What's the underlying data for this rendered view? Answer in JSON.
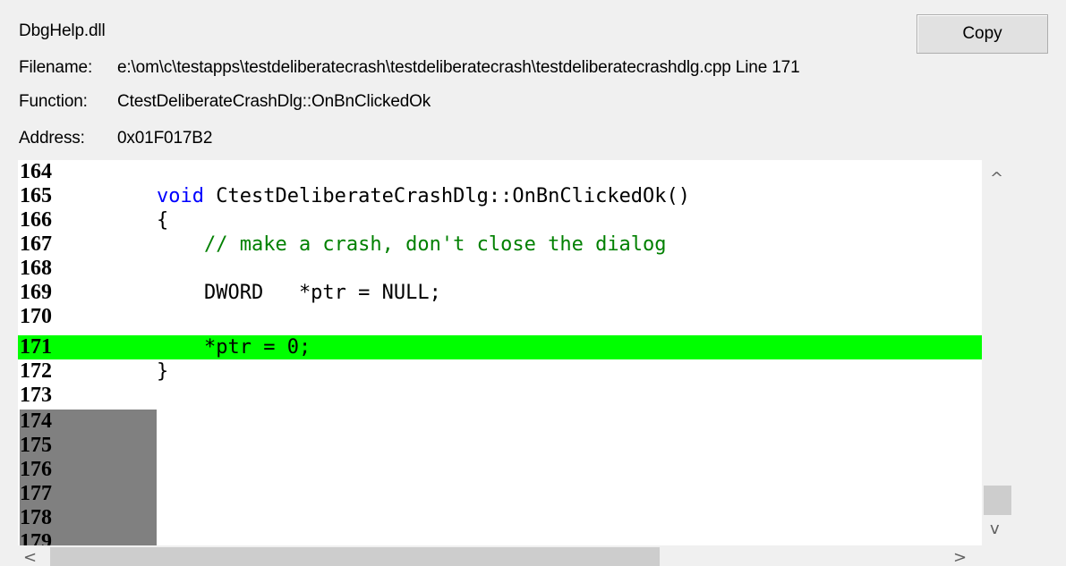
{
  "header": {
    "dll": "DbgHelp.dll",
    "filename_label": "Filename:",
    "filename_value": "e:\\om\\c\\testapps\\testdeliberatecrash\\testdeliberatecrash\\testdeliberatecrashdlg.cpp Line 171",
    "function_label": "Function:",
    "function_value": "CtestDeliberateCrashDlg::OnBnClickedOk",
    "address_label": "Address:",
    "address_value": "0x01F017B2"
  },
  "toolbar": {
    "copy_label": "Copy"
  },
  "code": {
    "rows": [
      {
        "number": "164",
        "text": ""
      },
      {
        "number": "165",
        "text_keyword": "void",
        "text_rest": " CtestDeliberateCrashDlg::OnBnClickedOk()"
      },
      {
        "number": "166",
        "text": "{"
      },
      {
        "number": "167",
        "comment": "    // make a crash, don't close the dialog"
      },
      {
        "number": "168",
        "text": ""
      },
      {
        "number": "169",
        "text": "    DWORD   *ptr = NULL;"
      },
      {
        "number": "170",
        "text": ""
      },
      {
        "number": "171",
        "text": "    *ptr = 0;"
      },
      {
        "number": "172",
        "text": "}"
      },
      {
        "number": "173",
        "text": ""
      },
      {
        "number": "174",
        "text": ""
      },
      {
        "number": "175",
        "text": ""
      },
      {
        "number": "176",
        "text": ""
      },
      {
        "number": "177",
        "text": ""
      },
      {
        "number": "178",
        "text": ""
      },
      {
        "number": "179",
        "text": ""
      }
    ]
  },
  "scrollbars": {
    "up_arrow": "^",
    "down_arrow": "v",
    "left_arrow": "<",
    "right_arrow": ">"
  },
  "colors": {
    "highlight": "#00ff00",
    "gutter": "#808080",
    "keyword": "#0000ff",
    "comment": "#008000",
    "background": "#f0f0f0"
  }
}
